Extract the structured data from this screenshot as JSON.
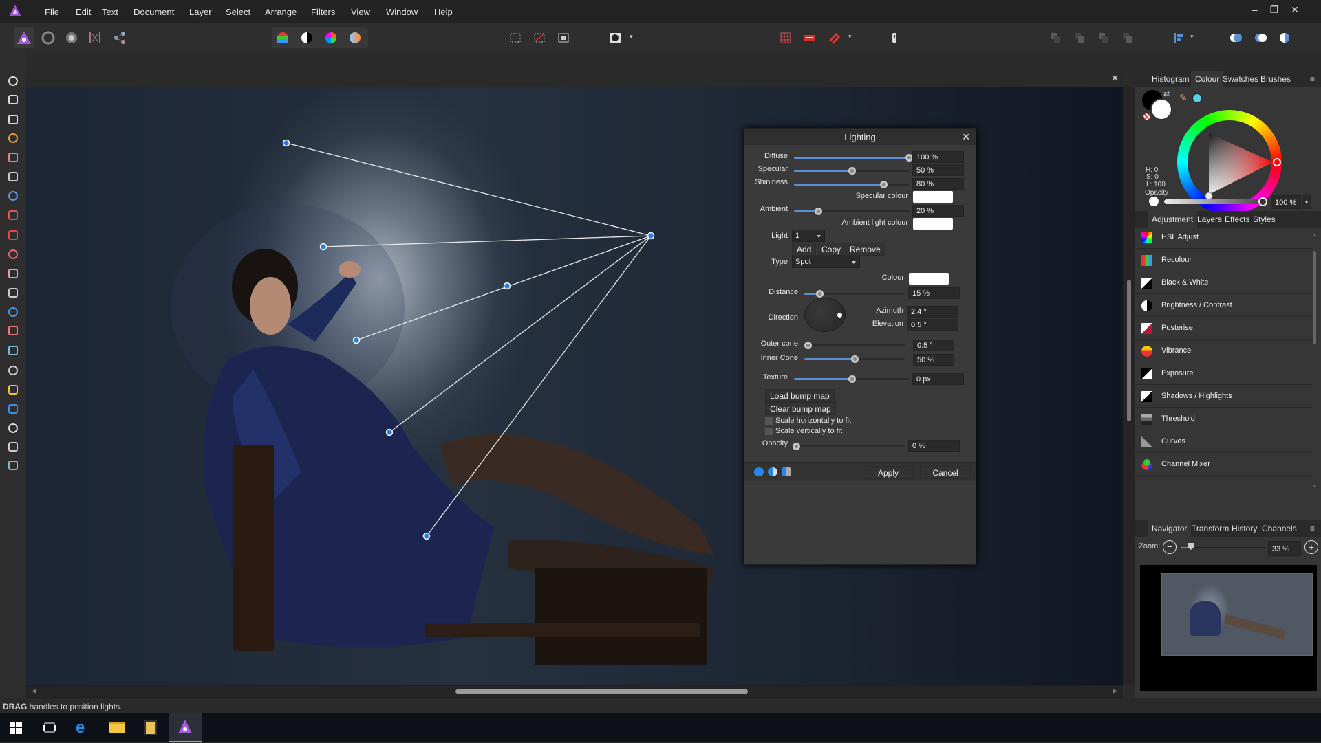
{
  "menu": [
    "File",
    "Edit",
    "Text",
    "Document",
    "Layer",
    "Select",
    "Arrange",
    "Filters",
    "View",
    "Window",
    "Help"
  ],
  "toolbar": {
    "personas": [
      "photo-persona-icon",
      "liquify-persona-icon",
      "develop-persona-icon",
      "tone-mapping-persona-icon",
      "export-persona-icon"
    ],
    "colour_tools": [
      "auto-levels-icon",
      "auto-contrast-icon",
      "auto-colour-icon",
      "auto-white-balance-icon"
    ]
  },
  "tools": [
    "hand-icon",
    "move-icon",
    "crop-icon",
    "eyedropper-icon",
    "selection-brush-icon",
    "marquee-icon",
    "flood-fill-icon",
    "colour-picker-icon",
    "paint-brush-icon",
    "clone-icon",
    "eraser-icon",
    "dodge-icon",
    "stamp-icon",
    "healing-icon",
    "blur-icon",
    "smudge-icon",
    "pen-icon",
    "rectangle-icon",
    "text-icon",
    "mesh-warp-icon",
    "zoom-icon"
  ],
  "status": {
    "bold": "DRAG",
    "text": " handles to position lights."
  },
  "dialog": {
    "title": "Lighting",
    "diffuse": {
      "label": "Diffuse",
      "value": "100 %",
      "level": 1.0
    },
    "specular": {
      "label": "Specular",
      "value": "50 %",
      "level": 0.5
    },
    "shininess": {
      "label": "Shininess",
      "value": "80 %",
      "level": 0.78
    },
    "specular_colour": {
      "label": "Specular colour",
      "color": "#ffffff"
    },
    "ambient": {
      "label": "Ambient",
      "value": "20 %",
      "level": 0.21
    },
    "ambient_colour": {
      "label": "Ambient light colour",
      "color": "#ffffff"
    },
    "light": {
      "label": "Light",
      "value": "1"
    },
    "add": "Add",
    "copy": "Copy",
    "remove": "Remove",
    "type": {
      "label": "Type",
      "value": "Spot"
    },
    "colour": {
      "label": "Colour",
      "color": "#ffffff"
    },
    "distance": {
      "label": "Distance",
      "value": "15 %",
      "level": 0.15
    },
    "direction": {
      "label": "Direction"
    },
    "azimuth": {
      "label": "Azimuth",
      "value": "2.4 °"
    },
    "elevation": {
      "label": "Elevation",
      "value": "0.5 °"
    },
    "outer_cone": {
      "label": "Outer cone",
      "value": "0.5 °",
      "level": 0.0
    },
    "inner_cone": {
      "label": "Inner Cone",
      "value": "50 %",
      "level": 0.5
    },
    "texture": {
      "label": "Texture",
      "value": "0 px",
      "level": 0.5
    },
    "load_bump": "Load bump map",
    "clear_bump": "Clear bump map",
    "scale_h": "Scale horizontally to fit",
    "scale_v": "Scale vertically to fit",
    "opacity": {
      "label": "Opacity",
      "value": "0 %",
      "level": 0.0
    },
    "apply": "Apply",
    "cancel": "Cancel"
  },
  "colour_panel": {
    "tabs": [
      "Histogram",
      "Colour",
      "Swatches",
      "Brushes"
    ],
    "active_tab": "Colour",
    "h": "H: 0",
    "s": "S: 0",
    "l": "L: 100",
    "opacity_label": "Opacity",
    "opacity_value": "100 %",
    "primary": "#000000",
    "secondary": "#ffffff",
    "picked": "#5bd0ea"
  },
  "adjust_panel": {
    "tabs": [
      "Adjustment",
      "Layers",
      "Effects",
      "Styles"
    ],
    "items": [
      {
        "label": "HSL Adjust",
        "icon": "hsl-adjust-icon"
      },
      {
        "label": "Recolour",
        "icon": "recolour-icon"
      },
      {
        "label": "Black & White",
        "icon": "black-white-icon"
      },
      {
        "label": "Brightness / Contrast",
        "icon": "brightness-contrast-icon"
      },
      {
        "label": "Posterise",
        "icon": "posterise-icon"
      },
      {
        "label": "Vibrance",
        "icon": "vibrance-icon"
      },
      {
        "label": "Exposure",
        "icon": "exposure-icon"
      },
      {
        "label": "Shadows / Highlights",
        "icon": "shadows-highlights-icon"
      },
      {
        "label": "Threshold",
        "icon": "threshold-icon"
      },
      {
        "label": "Curves",
        "icon": "curves-icon"
      },
      {
        "label": "Channel Mixer",
        "icon": "channel-mixer-icon"
      }
    ]
  },
  "navigator": {
    "tabs": [
      "Navigator",
      "Transform",
      "History",
      "Channels"
    ],
    "zoom_label": "Zoom:",
    "zoom_value": "33 %",
    "zoom_level": 0.12
  }
}
